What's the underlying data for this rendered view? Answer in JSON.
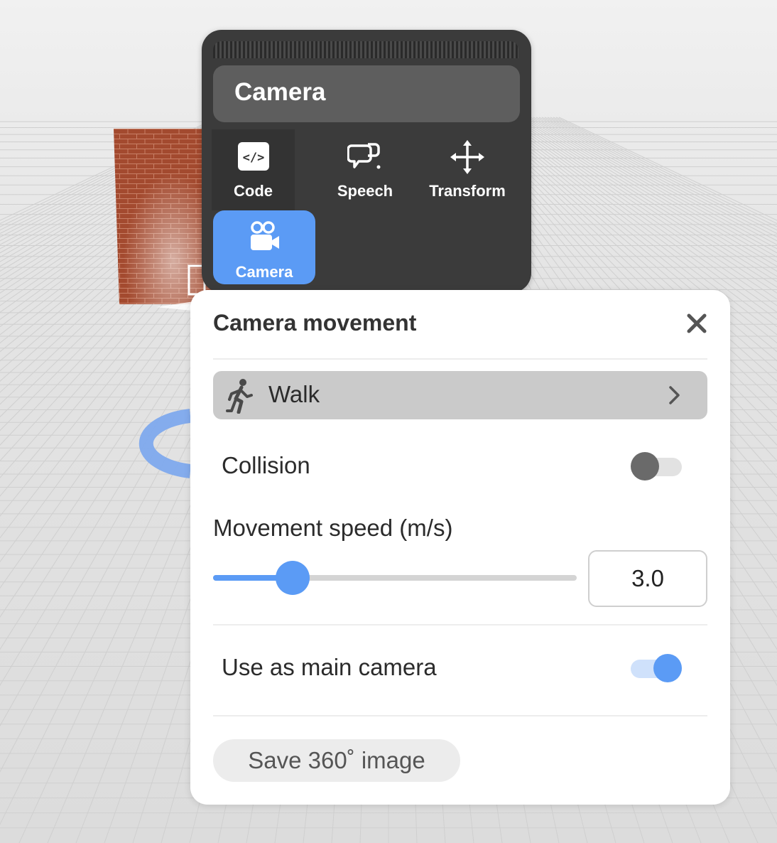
{
  "component_panel": {
    "title": "Camera",
    "tabs": [
      {
        "label": "Code",
        "icon": "code-icon"
      },
      {
        "label": "Speech",
        "icon": "speech-bubble-icon"
      },
      {
        "label": "Transform",
        "icon": "move-arrows-icon"
      },
      {
        "label": "Camera",
        "icon": "video-camera-icon"
      }
    ],
    "active_tab": "Camera"
  },
  "properties": {
    "title": "Camera movement",
    "movement_mode": {
      "label": "Walk",
      "icon": "walking-person-icon"
    },
    "collision": {
      "label": "Collision",
      "enabled": false
    },
    "speed": {
      "label": "Movement speed (m/s)",
      "value": "3.0",
      "slider_fraction": 0.18
    },
    "main_camera": {
      "label": "Use as main camera",
      "enabled": true
    },
    "save_button": "Save 360˚ image"
  },
  "colors": {
    "accent": "#5b9bf5",
    "panel_dark": "#3b3b3b",
    "brick": "#a6492f"
  }
}
